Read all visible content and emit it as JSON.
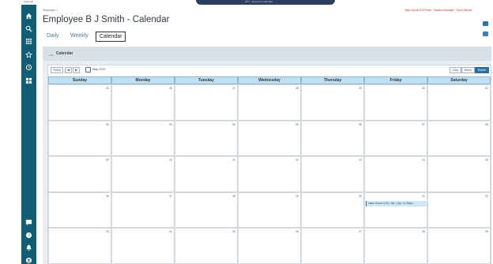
{
  "window": {
    "corner_tab": "Calendar"
  },
  "topbar": {
    "title": "ATG - Employee Calendar",
    "right_links": "https://quick.EXPTeam · System Manager · Ryan Silcock"
  },
  "breadcrumb": "Employee >",
  "page_title": "Employee B J Smith - Calendar",
  "tabs": [
    {
      "label": "Daily"
    },
    {
      "label": "Weekly"
    },
    {
      "label": "Calendar"
    }
  ],
  "section": {
    "title": "Calendar"
  },
  "toolbar": {
    "today": "Today",
    "prev": "◀",
    "next": "▶",
    "month_label": "May 2021",
    "views": [
      "Day",
      "Week",
      "Month"
    ]
  },
  "weekdays": [
    "Sunday",
    "Monday",
    "Tuesday",
    "Wednesday",
    "Thursday",
    "Friday",
    "Saturday"
  ],
  "weeks": [
    [
      "25",
      "26",
      "27",
      "28",
      "29",
      "30",
      "01"
    ],
    [
      "02",
      "03",
      "04",
      "05",
      "06",
      "07",
      "08"
    ],
    [
      "09",
      "10",
      "11",
      "12",
      "13",
      "14",
      "15"
    ],
    [
      "16",
      "17",
      "18",
      "19",
      "20",
      "21",
      "22"
    ],
    [
      "23",
      "24",
      "25",
      "26",
      "27",
      "28",
      "29"
    ]
  ],
  "event": {
    "text": "Labor Hours: 8.00 | Job: | Opr: 0 | Statu..."
  },
  "colors": {
    "sidebar": "#0f5e73",
    "accent": "#2b6ea2",
    "header_cells": "#bfe0f3"
  }
}
